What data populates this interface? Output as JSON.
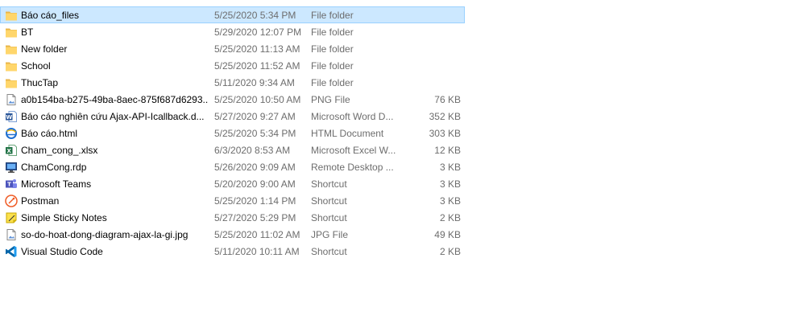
{
  "files": [
    {
      "name": "Báo cáo_files",
      "date": "5/25/2020 5:34 PM",
      "type": "File folder",
      "size": "",
      "icon": "folder-icon",
      "selected": true
    },
    {
      "name": "BT",
      "date": "5/29/2020 12:07 PM",
      "type": "File folder",
      "size": "",
      "icon": "folder-icon"
    },
    {
      "name": "New folder",
      "date": "5/25/2020 11:13 AM",
      "type": "File folder",
      "size": "",
      "icon": "folder-icon"
    },
    {
      "name": "School",
      "date": "5/25/2020 11:52 AM",
      "type": "File folder",
      "size": "",
      "icon": "folder-icon"
    },
    {
      "name": "ThucTap",
      "date": "5/11/2020 9:34 AM",
      "type": "File folder",
      "size": "",
      "icon": "folder-icon"
    },
    {
      "name": "a0b154ba-b275-49ba-8aec-875f687d6293...",
      "date": "5/25/2020 10:50 AM",
      "type": "PNG File",
      "size": "76 KB",
      "icon": "image-file-icon"
    },
    {
      "name": "Báo cáo nghiên cứu Ajax-API-Icallback.d...",
      "date": "5/27/2020 9:27 AM",
      "type": "Microsoft Word D...",
      "size": "352 KB",
      "icon": "word-document-icon"
    },
    {
      "name": "Báo cáo.html",
      "date": "5/25/2020 5:34 PM",
      "type": "HTML Document",
      "size": "303 KB",
      "icon": "html-document-icon"
    },
    {
      "name": "Cham_cong_.xlsx",
      "date": "6/3/2020 8:53 AM",
      "type": "Microsoft Excel W...",
      "size": "12 KB",
      "icon": "excel-workbook-icon"
    },
    {
      "name": "ChamCong.rdp",
      "date": "5/26/2020 9:09 AM",
      "type": "Remote Desktop ...",
      "size": "3 KB",
      "icon": "remote-desktop-icon"
    },
    {
      "name": "Microsoft Teams",
      "date": "5/20/2020 9:00 AM",
      "type": "Shortcut",
      "size": "3 KB",
      "icon": "teams-icon"
    },
    {
      "name": "Postman",
      "date": "5/25/2020 1:14 PM",
      "type": "Shortcut",
      "size": "3 KB",
      "icon": "postman-icon"
    },
    {
      "name": "Simple Sticky Notes",
      "date": "5/27/2020 5:29 PM",
      "type": "Shortcut",
      "size": "2 KB",
      "icon": "sticky-notes-icon"
    },
    {
      "name": "so-do-hoat-dong-diagram-ajax-la-gi.jpg",
      "date": "5/25/2020 11:02 AM",
      "type": "JPG File",
      "size": "49 KB",
      "icon": "image-file-icon"
    },
    {
      "name": "Visual Studio Code",
      "date": "5/11/2020 10:11 AM",
      "type": "Shortcut",
      "size": "2 KB",
      "icon": "vscode-icon"
    }
  ],
  "colors": {
    "selection_bg": "#cce8ff",
    "selection_border": "#99d1ff",
    "secondary_text": "#6d6d6d",
    "folder": "#ffd66b"
  }
}
